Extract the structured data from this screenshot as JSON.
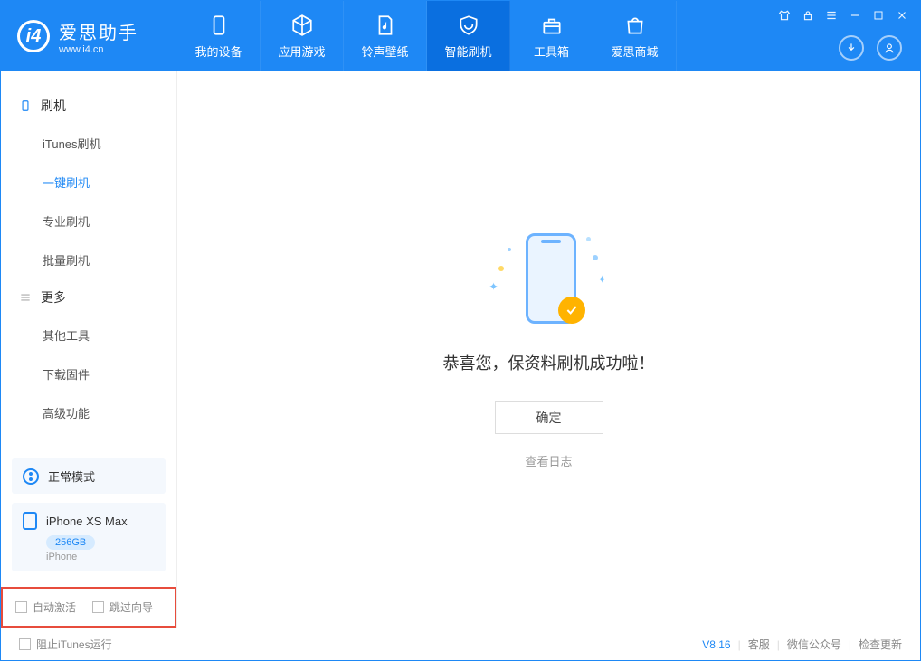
{
  "app": {
    "title": "爱思助手",
    "subtitle": "www.i4.cn"
  },
  "tabs": [
    {
      "label": "我的设备"
    },
    {
      "label": "应用游戏"
    },
    {
      "label": "铃声壁纸"
    },
    {
      "label": "智能刷机"
    },
    {
      "label": "工具箱"
    },
    {
      "label": "爱思商城"
    }
  ],
  "sidebar": {
    "group1": {
      "title": "刷机",
      "items": [
        "iTunes刷机",
        "一键刷机",
        "专业刷机",
        "批量刷机"
      ]
    },
    "group2": {
      "title": "更多",
      "items": [
        "其他工具",
        "下载固件",
        "高级功能"
      ]
    }
  },
  "device": {
    "mode": "正常模式",
    "name": "iPhone XS Max",
    "capacity": "256GB",
    "type": "iPhone"
  },
  "checkboxes": {
    "auto_activate": "自动激活",
    "skip_guide": "跳过向导"
  },
  "main": {
    "success_msg": "恭喜您，保资料刷机成功啦！",
    "ok": "确定",
    "view_log": "查看日志"
  },
  "footer": {
    "block_itunes": "阻止iTunes运行",
    "version": "V8.16",
    "support": "客服",
    "wechat": "微信公众号",
    "update": "检查更新"
  }
}
